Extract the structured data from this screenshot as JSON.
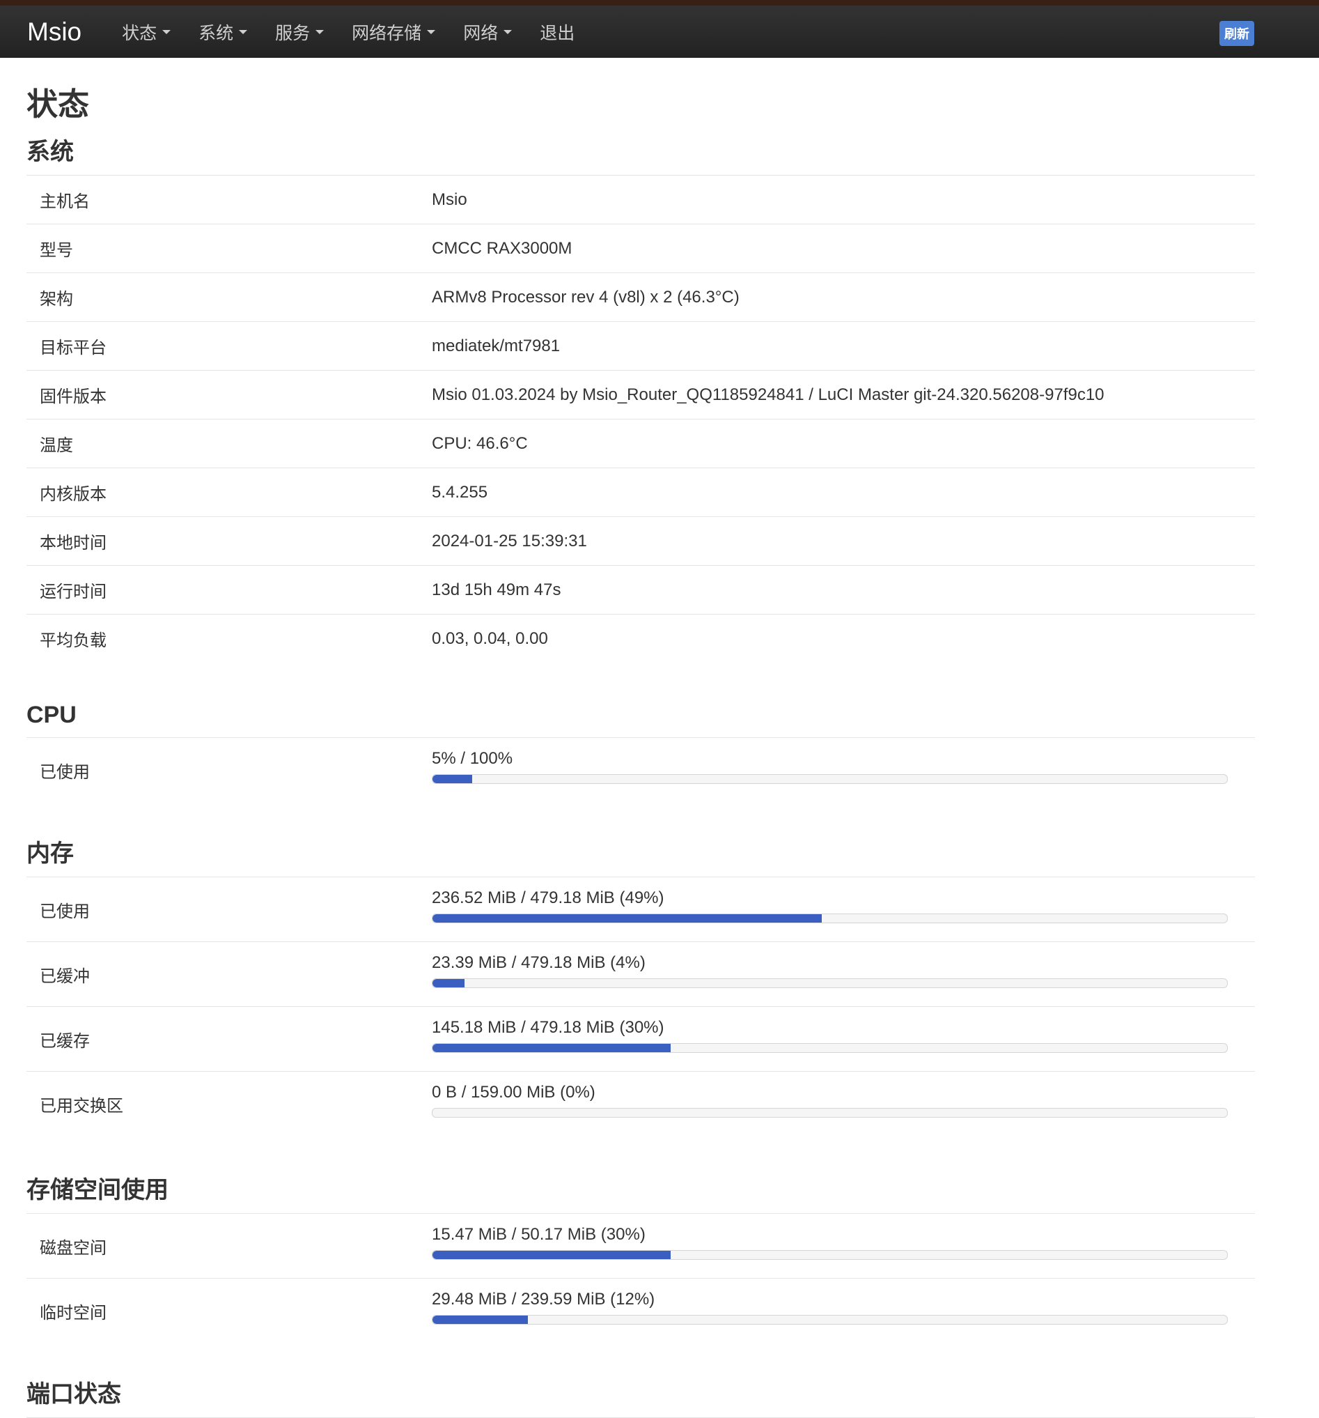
{
  "nav": {
    "brand": "Msio",
    "items": [
      {
        "label": "状态",
        "dropdown": true
      },
      {
        "label": "系统",
        "dropdown": true
      },
      {
        "label": "服务",
        "dropdown": true
      },
      {
        "label": "网络存储",
        "dropdown": true
      },
      {
        "label": "网络",
        "dropdown": true
      },
      {
        "label": "退出",
        "dropdown": false
      }
    ],
    "refresh_label": "刷新"
  },
  "page_title": "状态",
  "system": {
    "title": "系统",
    "rows": [
      {
        "label": "主机名",
        "value": "Msio"
      },
      {
        "label": "型号",
        "value": "CMCC RAX3000M"
      },
      {
        "label": "架构",
        "value": "ARMv8 Processor rev 4 (v8l) x 2 (46.3°C)"
      },
      {
        "label": "目标平台",
        "value": "mediatek/mt7981"
      },
      {
        "label": "固件版本",
        "value": "Msio 01.03.2024 by Msio_Router_QQ1185924841 / LuCI Master git-24.320.56208-97f9c10"
      },
      {
        "label": "温度",
        "value": "CPU: 46.6°C"
      },
      {
        "label": "内核版本",
        "value": "5.4.255"
      },
      {
        "label": "本地时间",
        "value": "2024-01-25 15:39:31"
      },
      {
        "label": "运行时间",
        "value": "13d 15h 49m 47s"
      },
      {
        "label": "平均负载",
        "value": "0.03, 0.04, 0.00"
      }
    ]
  },
  "cpu": {
    "title": "CPU",
    "rows": [
      {
        "label": "已使用",
        "text": "5% / 100%",
        "percent": 5
      }
    ]
  },
  "memory": {
    "title": "内存",
    "rows": [
      {
        "label": "已使用",
        "text": "236.52 MiB / 479.18 MiB (49%)",
        "percent": 49
      },
      {
        "label": "已缓冲",
        "text": "23.39 MiB / 479.18 MiB (4%)",
        "percent": 4
      },
      {
        "label": "已缓存",
        "text": "145.18 MiB / 479.18 MiB (30%)",
        "percent": 30
      },
      {
        "label": "已用交换区",
        "text": "0 B / 159.00 MiB (0%)",
        "percent": 0
      }
    ]
  },
  "storage": {
    "title": "存储空间使用",
    "rows": [
      {
        "label": "磁盘空间",
        "text": "15.47 MiB / 50.17 MiB (30%)",
        "percent": 30
      },
      {
        "label": "临时空间",
        "text": "29.48 MiB / 239.59 MiB (12%)",
        "percent": 12
      }
    ]
  },
  "ports": {
    "title": "端口状态"
  },
  "colors": {
    "bar_fill": "#3b5fc0",
    "refresh_button": "#4a7fd4",
    "navbar": "#2b2b2b"
  }
}
